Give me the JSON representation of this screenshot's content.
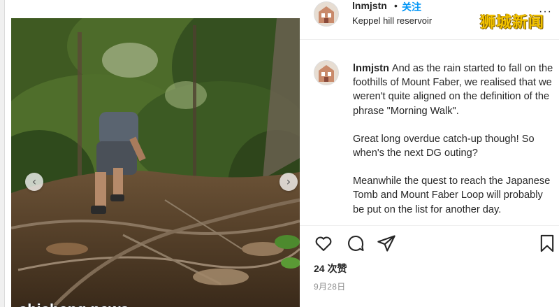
{
  "post": {
    "username": "lnmjstn",
    "separator": "•",
    "follow_label": "关注",
    "location": "Keppel hill reservoir",
    "more_label": "···"
  },
  "caption": {
    "username": "lnmjstn",
    "paragraph1": "And as the rain started to fall on the foothills of Mount Faber, we realised that we weren't quite aligned on the definition of the phrase \"Morning Walk\".",
    "paragraph2": "Great long overdue catch-up though! So when's the next DG outing?",
    "paragraph3": "Meanwhile the quest to reach the Japanese Tomb and Mount Faber Loop will probably be put on the list for another day."
  },
  "carousel": {
    "prev_label": "‹",
    "next_label": "›"
  },
  "engagement": {
    "likes": "24 次赞",
    "date": "9月28日"
  },
  "icons": [
    "heart-icon",
    "comment-icon",
    "share-icon",
    "bookmark-icon",
    "chevron-left-icon",
    "chevron-right-icon"
  ],
  "watermarks": {
    "top": "狮城新闻",
    "bottom": "shicheng.news"
  },
  "colors": {
    "follow": "#0095f6",
    "text": "#262626",
    "muted": "#8e8e8e",
    "watermark_top": "#f2c200"
  }
}
